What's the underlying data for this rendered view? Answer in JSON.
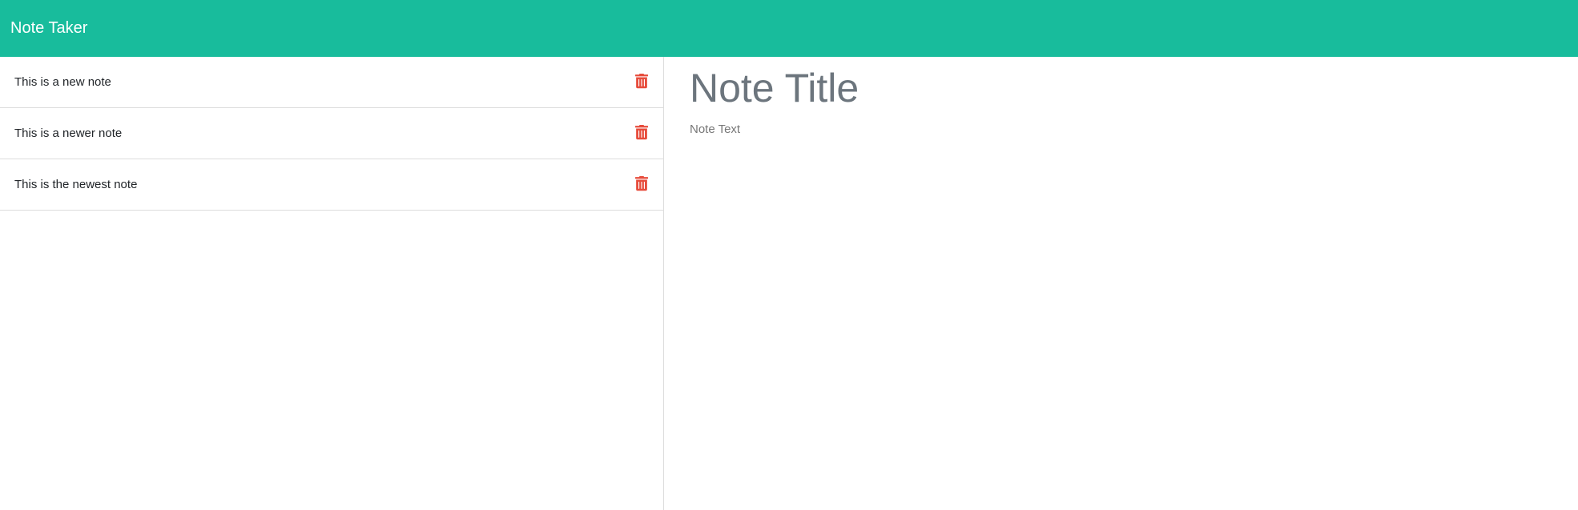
{
  "app": {
    "brand": "Note Taker"
  },
  "colors": {
    "navbar": "#18bc9c",
    "delete_icon": "#e74c3c",
    "divider": "#dddddd"
  },
  "notes": [
    {
      "title": "This is a new note",
      "icon": "trash-icon"
    },
    {
      "title": "This is a newer note",
      "icon": "trash-icon"
    },
    {
      "title": "This is the newest note",
      "icon": "trash-icon"
    }
  ],
  "editor": {
    "title_placeholder": "Note Title",
    "text_placeholder": "Note Text",
    "title_value": "",
    "text_value": ""
  }
}
